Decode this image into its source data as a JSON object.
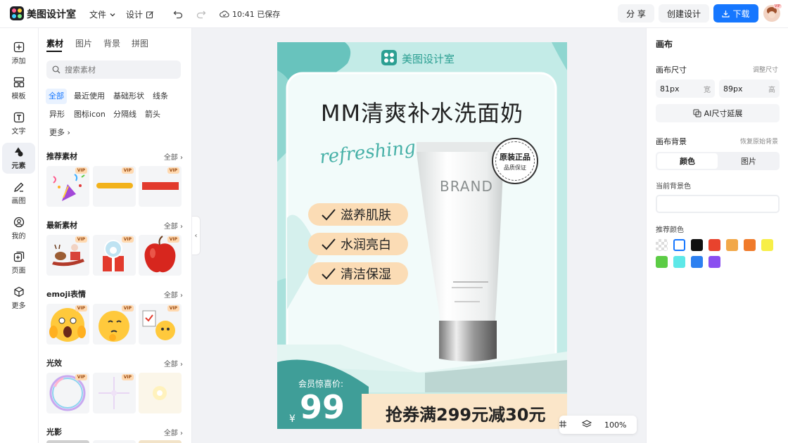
{
  "app": {
    "name": "美图设计室"
  },
  "topbar": {
    "file_menu": "文件",
    "design_menu": "设计",
    "save_status": "10:41 已保存",
    "share": "分 享",
    "create": "创建设计",
    "download": "下载",
    "avatar_badge": "VIP"
  },
  "leftnav": [
    {
      "label": "添加",
      "icon": "plus-square-icon"
    },
    {
      "label": "模板",
      "icon": "template-icon"
    },
    {
      "label": "文字",
      "icon": "text-icon"
    },
    {
      "label": "元素",
      "icon": "shapes-icon"
    },
    {
      "label": "画图",
      "icon": "pen-icon"
    },
    {
      "label": "我的",
      "icon": "user-icon"
    },
    {
      "label": "页面",
      "icon": "page-add-icon"
    },
    {
      "label": "更多",
      "icon": "cube-icon"
    }
  ],
  "panel": {
    "tabs": [
      "素材",
      "图片",
      "背景",
      "拼图"
    ],
    "search_placeholder": "搜索素材",
    "chips_row1": [
      "全部",
      "最近使用",
      "基础形状",
      "线条"
    ],
    "chips_row2": [
      "异形",
      "图标icon",
      "分隔线",
      "箭头"
    ],
    "chips_row3": [
      "更多"
    ],
    "all_label": "全部",
    "vip": "VIP",
    "sections": [
      "推荐素材",
      "最新素材",
      "emoji表情",
      "光效",
      "光影"
    ]
  },
  "poster": {
    "brand": "美图设计室",
    "title": "MM清爽补水洗面奶",
    "script": "refreshing",
    "features": [
      "滋养肌肤",
      "水润亮白",
      "清洁保湿"
    ],
    "seal_line1": "原装正品",
    "seal_line2": "品质保证",
    "tube_brand": "BRAND",
    "member_label": "会员惊喜价:",
    "currency": "¥",
    "price": "99",
    "coupon": "抢券满299元减30元"
  },
  "zoom": {
    "level": "100%"
  },
  "rightpanel": {
    "title": "画布",
    "size_label": "画布尺寸",
    "size_link": "调整尺寸",
    "width_value": "81px",
    "width_unit": "宽",
    "height_value": "89px",
    "height_unit": "高",
    "ai_extend": "AI尺寸延展",
    "bg_label": "画布背景",
    "bg_reset": "恢复原始背景",
    "seg_color": "颜色",
    "seg_image": "图片",
    "current_bg_label": "当前背景色",
    "recommend_label": "推荐颜色",
    "colors": [
      "transparent",
      "#ffffff",
      "#111111",
      "#e8432d",
      "#f2a848",
      "#f07a2a",
      "#f7ef47",
      "#5ccc45",
      "#5ee8e8",
      "#2d80f0",
      "#8a4ef0"
    ]
  }
}
